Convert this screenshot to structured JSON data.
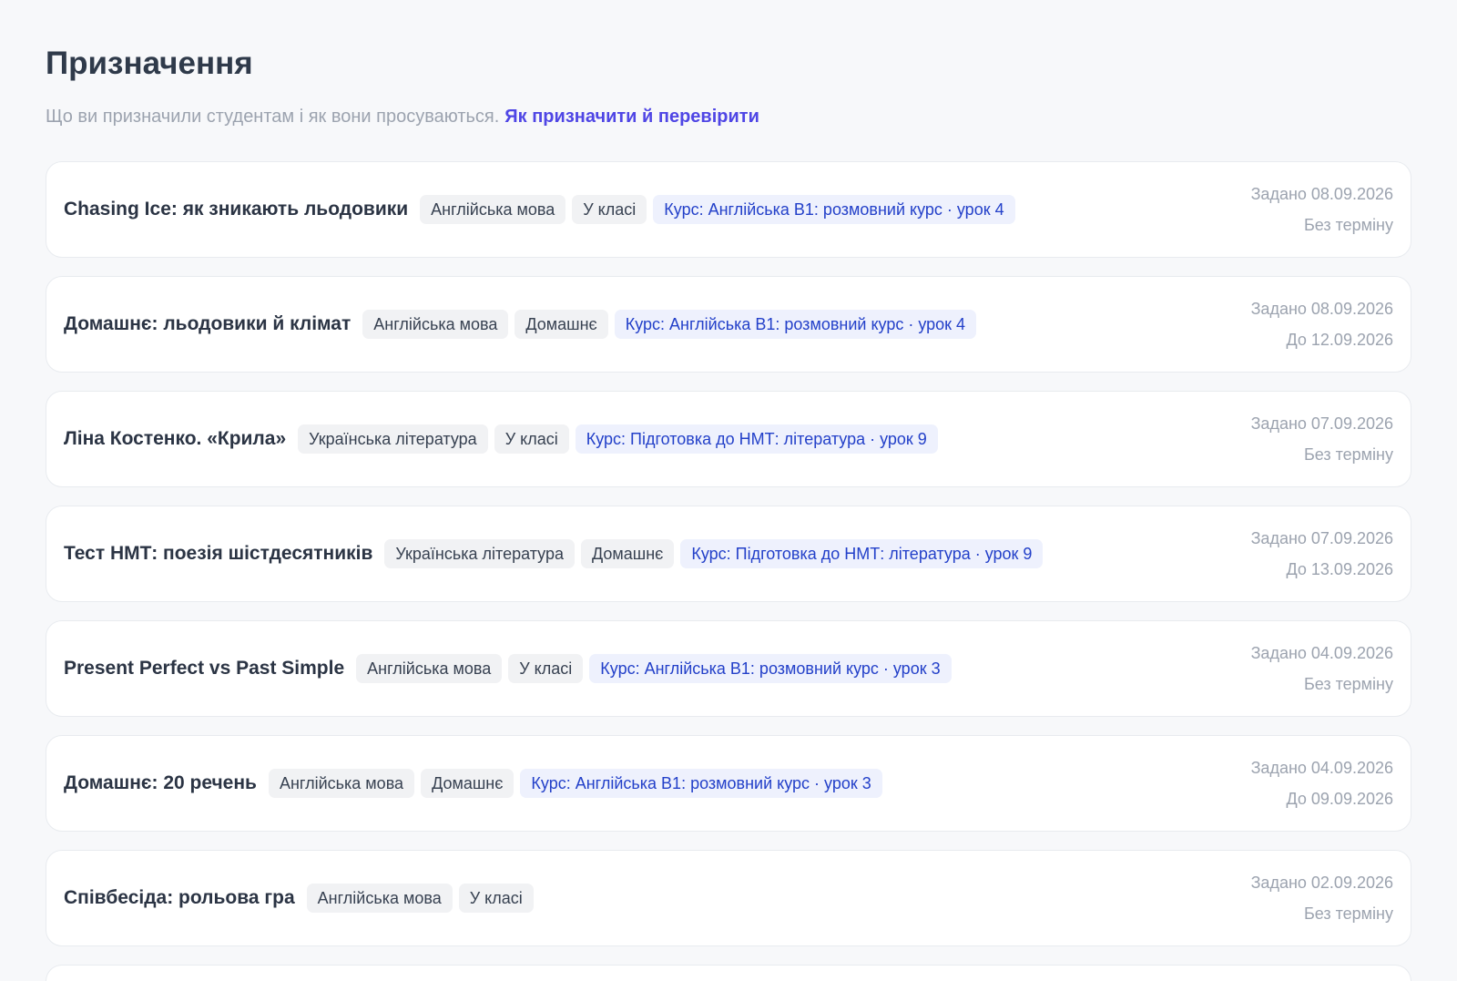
{
  "header": {
    "title": "Призначення",
    "subtitle": "Що ви призначили студентам і як вони просуваються.",
    "help_link": "Як призначити й перевірити"
  },
  "assignments": [
    {
      "title": "Chasing Ice: як зникають льодовики",
      "subject": "Англійська мова",
      "mode": "У класі",
      "course": "Курс: Англійська B1: розмовний курс · урок 4",
      "assigned": "Задано 08.09.2026",
      "due": "Без терміну"
    },
    {
      "title": "Домашнє: льодовики й клімат",
      "subject": "Англійська мова",
      "mode": "Домашнє",
      "course": "Курс: Англійська B1: розмовний курс · урок 4",
      "assigned": "Задано 08.09.2026",
      "due": "До 12.09.2026"
    },
    {
      "title": "Ліна Костенко. «Крила»",
      "subject": "Українська література",
      "mode": "У класі",
      "course": "Курс: Підготовка до НМТ: література · урок 9",
      "assigned": "Задано 07.09.2026",
      "due": "Без терміну"
    },
    {
      "title": "Тест НМТ: поезія шістдесятників",
      "subject": "Українська література",
      "mode": "Домашнє",
      "course": "Курс: Підготовка до НМТ: література · урок 9",
      "assigned": "Задано 07.09.2026",
      "due": "До 13.09.2026"
    },
    {
      "title": "Present Perfect vs Past Simple",
      "subject": "Англійська мова",
      "mode": "У класі",
      "course": "Курс: Англійська B1: розмовний курс · урок 3",
      "assigned": "Задано 04.09.2026",
      "due": "Без терміну"
    },
    {
      "title": "Домашнє: 20 речень",
      "subject": "Англійська мова",
      "mode": "Домашнє",
      "course": "Курс: Англійська B1: розмовний курс · урок 3",
      "assigned": "Задано 04.09.2026",
      "due": "До 09.09.2026"
    },
    {
      "title": "Співбесіда: рольова гра",
      "subject": "Англійська мова",
      "mode": "У класі",
      "course": "",
      "assigned": "Задано 02.09.2026",
      "due": "Без терміну"
    }
  ],
  "colors": {
    "accent": "#4f46e5",
    "course_tag_text": "#2340c9",
    "course_tag_bg": "#eef1fd",
    "muted_text": "#9ca3af"
  }
}
